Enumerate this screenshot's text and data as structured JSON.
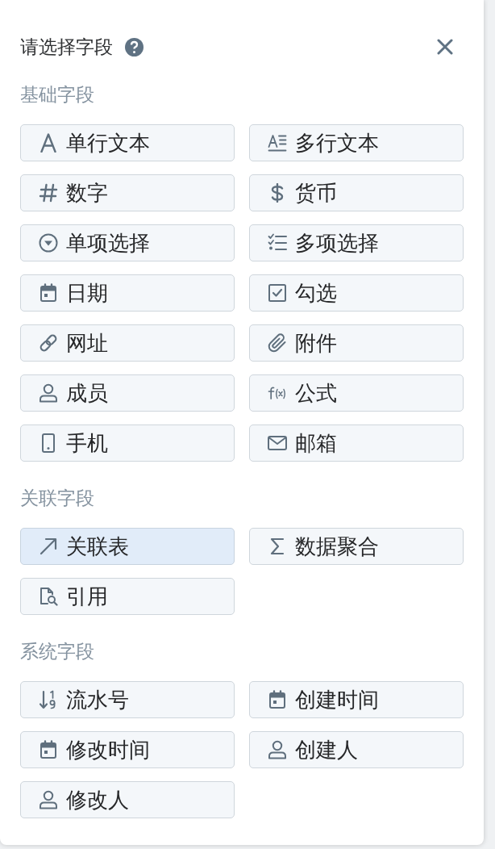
{
  "dialog": {
    "title": "请选择字段"
  },
  "sections": [
    {
      "label": "基础字段",
      "fields": [
        {
          "kind": "text",
          "label": "单行文本",
          "selected": false
        },
        {
          "kind": "multiline",
          "label": "多行文本",
          "selected": false
        },
        {
          "kind": "number",
          "label": "数字",
          "selected": false
        },
        {
          "kind": "currency",
          "label": "货币",
          "selected": false
        },
        {
          "kind": "select",
          "label": "单项选择",
          "selected": false
        },
        {
          "kind": "multiselect",
          "label": "多项选择",
          "selected": false
        },
        {
          "kind": "date",
          "label": "日期",
          "selected": false
        },
        {
          "kind": "checkbox",
          "label": "勾选",
          "selected": false
        },
        {
          "kind": "url",
          "label": "网址",
          "selected": false
        },
        {
          "kind": "attachment",
          "label": "附件",
          "selected": false
        },
        {
          "kind": "member",
          "label": "成员",
          "selected": false
        },
        {
          "kind": "formula",
          "label": "公式",
          "selected": false
        },
        {
          "kind": "phone",
          "label": "手机",
          "selected": false
        },
        {
          "kind": "email",
          "label": "邮箱",
          "selected": false
        }
      ]
    },
    {
      "label": "关联字段",
      "fields": [
        {
          "kind": "relation",
          "label": "关联表",
          "selected": true
        },
        {
          "kind": "rollup",
          "label": "数据聚合",
          "selected": false
        },
        {
          "kind": "lookup",
          "label": "引用",
          "selected": false
        }
      ]
    },
    {
      "label": "系统字段",
      "fields": [
        {
          "kind": "serial",
          "label": "流水号",
          "selected": false
        },
        {
          "kind": "created",
          "label": "创建时间",
          "selected": false
        },
        {
          "kind": "modified",
          "label": "修改时间",
          "selected": false
        },
        {
          "kind": "creator",
          "label": "创建人",
          "selected": false
        },
        {
          "kind": "editor",
          "label": "修改人",
          "selected": false
        }
      ]
    }
  ]
}
